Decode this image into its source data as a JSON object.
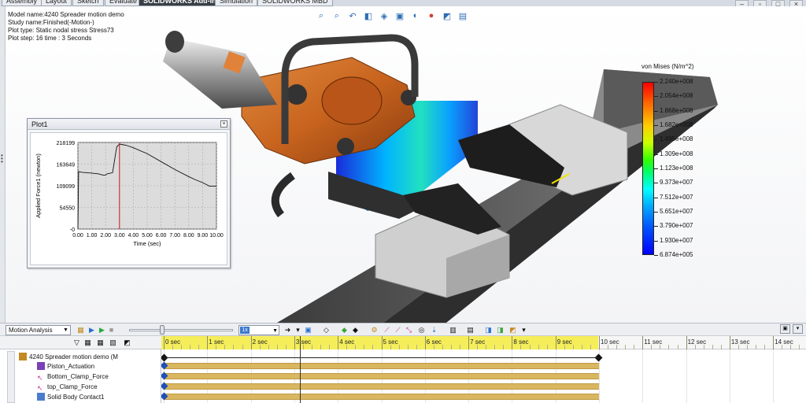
{
  "tabs": [
    "Assembly",
    "Layout",
    "Sketch",
    "Evaluate",
    "SOLIDWORKS Add-Ins",
    "Simulation",
    "SOLIDWORKS MBD"
  ],
  "active_tab": "SOLIDWORKS Add-Ins",
  "model_info": {
    "line1": "Model name:4240 Spreader motion demo",
    "line2": "Study name:Finished(-Motion-)",
    "line3": "Plot type: Static nodal stress Stress73",
    "line4": "Plot step: 16   time : 3 Seconds"
  },
  "legend": {
    "title": "von Mises (N/m^2)",
    "values": [
      "2.240e+008",
      "2.054e+008",
      "1.868e+008",
      "1.682e+008",
      "1.495e+008",
      "1.309e+008",
      "1.123e+008",
      "9.373e+007",
      "7.512e+007",
      "5.651e+007",
      "3.790e+007",
      "1.930e+007",
      "6.874e+005"
    ]
  },
  "plot": {
    "window_title": "Plot1"
  },
  "chart_data": {
    "type": "line",
    "title": "",
    "xlabel": "Time (sec)",
    "ylabel": "Applied Force1 (newton)",
    "xlim": [
      0,
      10
    ],
    "ylim": [
      0,
      218199
    ],
    "x_ticks": [
      "0.00",
      "1.00",
      "2.00",
      "3.00",
      "4.00",
      "5.00",
      "6.00",
      "7.00",
      "8.00",
      "9.00",
      "10.00"
    ],
    "y_ticks": [
      "-0",
      "54550",
      "109099",
      "163649",
      "218199"
    ],
    "grid": true,
    "marker_x": 3.0,
    "series": [
      {
        "x": [
          0.0,
          0.05,
          0.3,
          1.0,
          1.5,
          1.8,
          2.0,
          2.1,
          2.5,
          2.8,
          3.0,
          3.2,
          3.5,
          4.0,
          5.0,
          6.0,
          7.0,
          8.0,
          8.5,
          9.0,
          9.5,
          10.0
        ],
        "y": [
          0,
          145000,
          143000,
          141000,
          139000,
          136000,
          136000,
          139000,
          142000,
          207000,
          214000,
          213000,
          211000,
          205000,
          190000,
          170000,
          150000,
          132000,
          124000,
          117000,
          108000,
          108000
        ]
      }
    ]
  },
  "motion": {
    "analysis_type": "Motion Analysis",
    "speed_value": "1x",
    "root": "4240 Spreader motion demo  (M",
    "items": [
      "Piston_Actuation",
      "Bottom_Clamp_Force",
      "top_Clamp_Force",
      "Solid Body Contact1"
    ],
    "ruler_labels": [
      "0 sec",
      "1 sec",
      "2 sec",
      "3 sec",
      "4 sec",
      "5 sec",
      "6 sec",
      "7 sec",
      "8 sec",
      "9 sec",
      "10 sec",
      "11 sec",
      "12 sec",
      "13 sec",
      "14 sec"
    ]
  },
  "colors": {
    "timeline_active": "#f5ee5a",
    "time_bar": "#d9b660",
    "key_blue": "#1f4fb8",
    "orange_part": "#c8641e"
  },
  "icons": [
    "zoom-fit-icon",
    "zoom-area-icon",
    "previous-view-icon",
    "section-view-icon",
    "view-orientation-icon",
    "display-style-icon",
    "hide-show-icon",
    "appearance-icon",
    "scene-icon",
    "display-manager-icon",
    "calculate-icon",
    "play-icon",
    "stop-icon",
    "save-animation-icon",
    "filter-icon",
    "zoom-in-icon",
    "zoom-out-icon"
  ]
}
